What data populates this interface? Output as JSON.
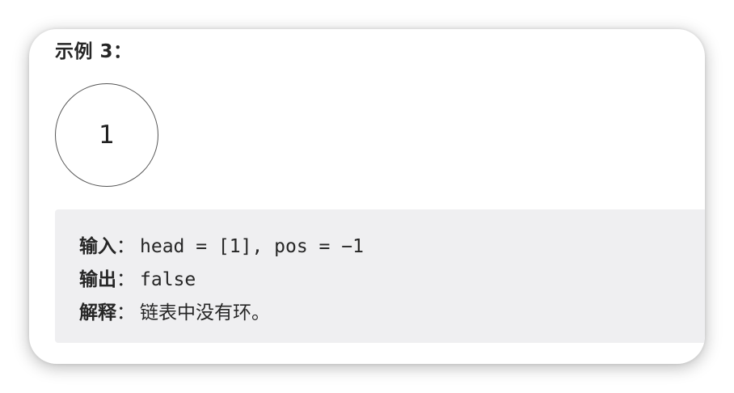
{
  "example": {
    "title": "示例 3："
  },
  "diagram": {
    "node_value": "1"
  },
  "io": {
    "input_label": "输入",
    "input_value": "head = [1], pos = −1",
    "output_label": "输出",
    "output_value": "false",
    "explanation_label": "解释",
    "explanation_value": "链表中没有环。",
    "colon": "："
  }
}
